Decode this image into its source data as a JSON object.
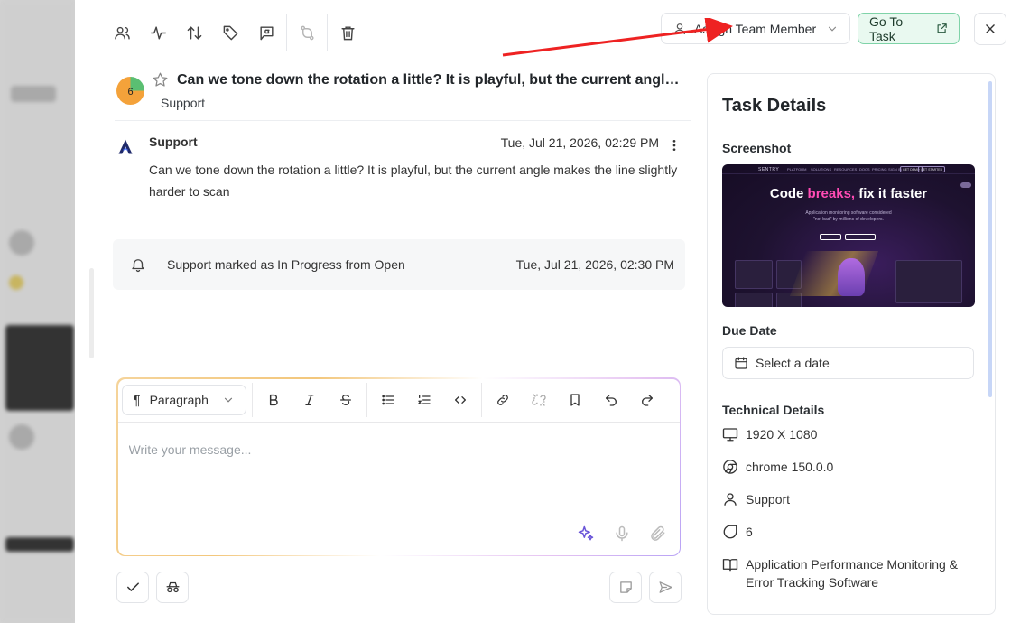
{
  "colors": {
    "accent_green": "#7fd3a8",
    "arrow_red": "#ee2222",
    "ai_purple": "#6a55d8"
  },
  "header": {
    "toolbar_icons": [
      "users-icon",
      "activity-icon",
      "sort-icon",
      "tag-icon",
      "flag-message-icon",
      "merge-icon",
      "trash-icon"
    ],
    "assign_label": "Assign Team Member",
    "goto_label": "Go To Task"
  },
  "conversation": {
    "priority": "6",
    "title": "Can we tone down the rotation a little? It is playful, but the current angle...",
    "subtitle": "Support"
  },
  "message": {
    "sender": "Support",
    "time": "Tue, Jul 21, 2026, 02:29 PM",
    "body": "Can we tone down the rotation a little? It is playful, but the current angle makes the line slightly harder to scan"
  },
  "activity": {
    "text": "Support marked as In Progress from Open",
    "time": "Tue, Jul 21, 2026, 02:30 PM"
  },
  "editor": {
    "paragraph_label": "Paragraph",
    "placeholder": "Write your message..."
  },
  "sidebar": {
    "title": "Task Details",
    "screenshot_label": "Screenshot",
    "screenshot": {
      "brand": "SENTRY",
      "nav": [
        "PLATFORM",
        "SOLUTIONS",
        "RESOURCES",
        "DOCS",
        "PRICING",
        "SIGN IN"
      ],
      "nav_buttons": [
        "GET DEMO",
        "GET STARTED"
      ],
      "headline_a": "Code ",
      "headline_b": "breaks,",
      "headline_c": " fix it faster",
      "subline_1": "Application monitoring software considered",
      "subline_2": "\"not bad\" by millions of developers."
    },
    "due_date_label": "Due Date",
    "due_date_placeholder": "Select a date",
    "tech_label": "Technical Details",
    "resolution": "1920 X 1080",
    "browser": "chrome 150.0.0",
    "user": "Support",
    "priority": "6",
    "project": "Application Performance Monitoring & Error Tracking Software"
  }
}
